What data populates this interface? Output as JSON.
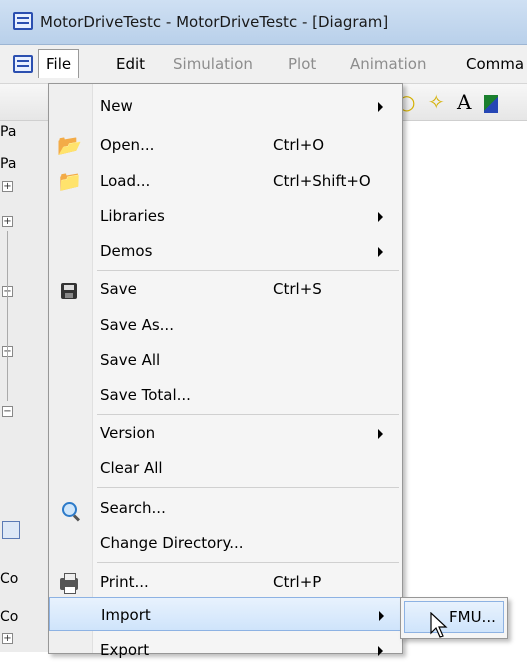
{
  "window": {
    "title": "MotorDriveTestc - MotorDriveTestc - [Diagram]"
  },
  "menubar": {
    "items": [
      {
        "label": "File",
        "active": true,
        "disabled": false
      },
      {
        "label": "Edit",
        "disabled": false
      },
      {
        "label": "Simulation",
        "disabled": true
      },
      {
        "label": "Plot",
        "disabled": true
      },
      {
        "label": "Animation",
        "disabled": true
      },
      {
        "label": "Comma",
        "disabled": false
      }
    ]
  },
  "left_panel": {
    "labels": [
      "Pa",
      "Pa",
      "Co",
      "Co"
    ]
  },
  "file_menu": {
    "items": [
      {
        "label": "New",
        "shortcut": "",
        "submenu": true,
        "icon": ""
      },
      {
        "label": "Open...",
        "shortcut": "Ctrl+O",
        "submenu": false,
        "icon": "open-folder-icon"
      },
      {
        "label": "Load...",
        "shortcut": "Ctrl+Shift+O",
        "submenu": false,
        "icon": "load-folder-icon"
      },
      {
        "label": "Libraries",
        "shortcut": "",
        "submenu": true,
        "icon": ""
      },
      {
        "label": "Demos",
        "shortcut": "",
        "submenu": true,
        "icon": ""
      },
      {
        "label": "Save",
        "shortcut": "Ctrl+S",
        "submenu": false,
        "icon": "floppy-disk-icon"
      },
      {
        "label": "Save As...",
        "shortcut": "",
        "submenu": false,
        "icon": ""
      },
      {
        "label": "Save All",
        "shortcut": "",
        "submenu": false,
        "icon": ""
      },
      {
        "label": "Save Total...",
        "shortcut": "",
        "submenu": false,
        "icon": ""
      },
      {
        "label": "Version",
        "shortcut": "",
        "submenu": true,
        "icon": ""
      },
      {
        "label": "Clear All",
        "shortcut": "",
        "submenu": false,
        "icon": ""
      },
      {
        "label": "Search...",
        "shortcut": "",
        "submenu": false,
        "icon": "magnifier-icon"
      },
      {
        "label": "Change Directory...",
        "shortcut": "",
        "submenu": false,
        "icon": ""
      },
      {
        "label": "Print...",
        "shortcut": "Ctrl+P",
        "submenu": false,
        "icon": "printer-icon"
      },
      {
        "label": "Import",
        "shortcut": "",
        "submenu": true,
        "icon": "",
        "highlighted": true
      },
      {
        "label": "Export",
        "shortcut": "",
        "submenu": true,
        "icon": ""
      }
    ]
  },
  "import_submenu": {
    "items": [
      {
        "label": "FMU...",
        "highlighted": true
      }
    ]
  }
}
